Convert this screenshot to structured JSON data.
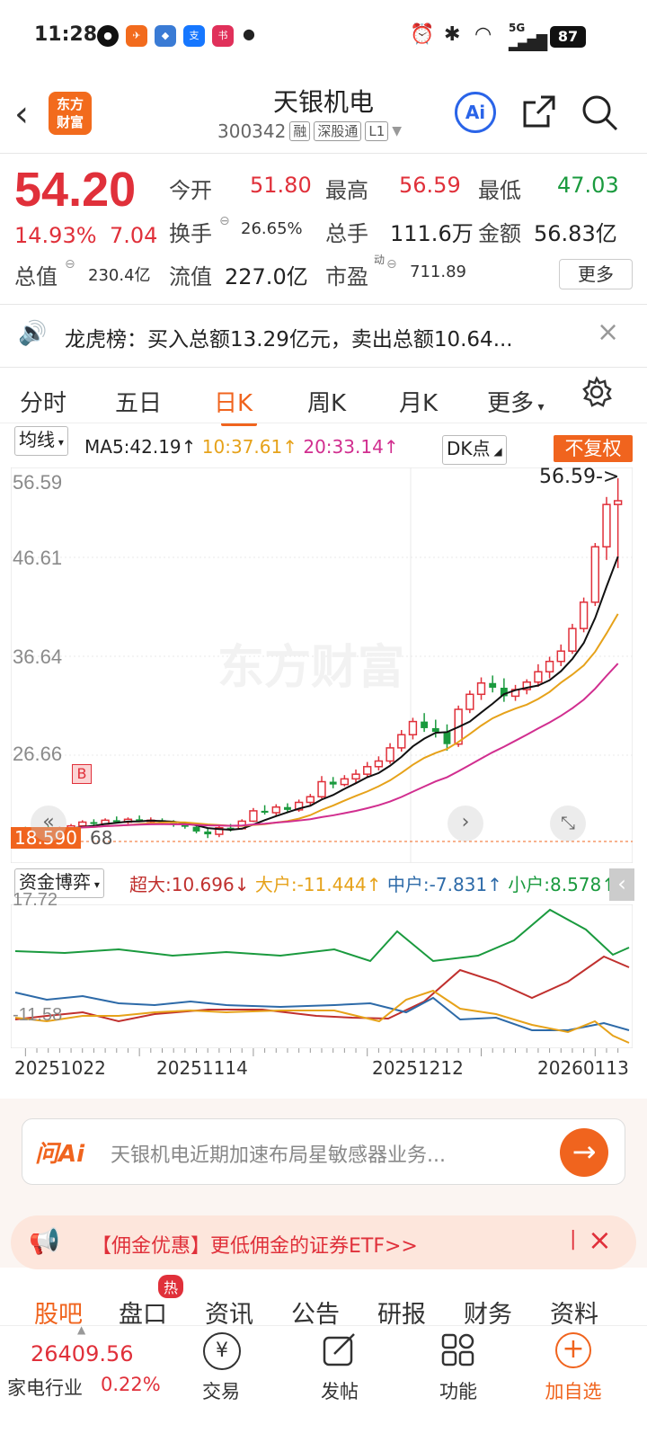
{
  "status_bar": {
    "time": "11:28",
    "battery": "87",
    "network": "5G"
  },
  "header": {
    "title": "天银机电",
    "code": "300342",
    "tag_rong": "融",
    "tag_market": "深股通",
    "tag_level": "L1",
    "logo_text_1": "东方",
    "logo_text_2": "财富"
  },
  "quote": {
    "price": "54.20",
    "change_pct": "14.93%",
    "change": "7.04",
    "open_label": "今开",
    "open": "51.80",
    "high_label": "最高",
    "high": "56.59",
    "low_label": "最低",
    "low": "47.03",
    "turnover_label": "换手",
    "turnover": "26.65%",
    "volume_label": "总手",
    "volume": "111.6万",
    "amount_label": "金额",
    "amount": "56.83亿",
    "total_value_label": "总值",
    "total_value": "230.4亿",
    "float_value_label": "流值",
    "float_value": "227.0亿",
    "pe_label": "市盈",
    "pe_sup": "动",
    "pe": "711.89",
    "more_label": "更多"
  },
  "notice": {
    "text": "龙虎榜：买入总额13.29亿元，卖出总额10.64..."
  },
  "tabs": [
    "分时",
    "五日",
    "日K",
    "周K",
    "月K",
    "更多"
  ],
  "active_tab": "日K",
  "kline": {
    "ma_select": "均线",
    "ma5": "MA5:42.19",
    "ma10": "10:37.61",
    "ma20": "20:33.14",
    "dk_label": "DK点",
    "fq_label": "不复权",
    "y_labels": [
      "56.59",
      "46.61",
      "36.64",
      "26.66"
    ],
    "high_marker": "56.59->",
    "low_marker": "18.590",
    "low_marker_suffix": "68",
    "watermark": "东方财富"
  },
  "fund": {
    "select": "资金博弈",
    "super_large": "超大:10.696",
    "large": "大户:-11.444",
    "medium": "中户:-7.831",
    "small": "小户:8.578",
    "y_top": "17.72",
    "y_bottom": "-11.58",
    "dates": [
      "20251022",
      "20251114",
      "20251212",
      "20260113"
    ]
  },
  "ai": {
    "brand": "问Ai",
    "placeholder": "天银机电近期加速布局星敏感器业务..."
  },
  "promo": {
    "text": "【佣金优惠】更低佣金的证券ETF>>"
  },
  "bottom_tabs": [
    "股吧",
    "盘口",
    "资讯",
    "公告",
    "研报",
    "财务",
    "资料"
  ],
  "hot_badge": "热",
  "index_info": {
    "value": "26409.56",
    "name": "家电行业",
    "change": "0.22%"
  },
  "nav": [
    "交易",
    "发帖",
    "功能",
    "加自选"
  ],
  "colors": {
    "up": "#e0303a",
    "down": "#1a9a3e",
    "accent": "#f0641e"
  },
  "chart_data": {
    "type": "candlestick",
    "ylim": [
      16.6,
      56.59
    ],
    "candles": [
      [
        19.2,
        19.5,
        18.9,
        19.1
      ],
      [
        19.1,
        19.4,
        18.8,
        19.3
      ],
      [
        19.3,
        19.6,
        19.0,
        19.2
      ],
      [
        19.2,
        19.5,
        19.0,
        19.4
      ],
      [
        19.4,
        19.8,
        19.2,
        19.6
      ],
      [
        19.6,
        20.2,
        19.4,
        20.0
      ],
      [
        20.0,
        20.3,
        19.6,
        19.8
      ],
      [
        19.8,
        20.4,
        19.7,
        20.2
      ],
      [
        20.2,
        20.6,
        19.9,
        20.0
      ],
      [
        20.0,
        20.5,
        19.8,
        20.3
      ],
      [
        20.3,
        20.7,
        20.0,
        20.1
      ],
      [
        20.1,
        20.5,
        19.8,
        20.2
      ],
      [
        20.2,
        20.4,
        19.7,
        19.9
      ],
      [
        19.9,
        20.2,
        19.5,
        19.7
      ],
      [
        19.7,
        20.0,
        19.3,
        19.5
      ],
      [
        19.5,
        19.8,
        18.8,
        19.0
      ],
      [
        19.0,
        19.4,
        18.3,
        18.7
      ],
      [
        18.7,
        19.6,
        18.4,
        19.4
      ],
      [
        19.4,
        19.8,
        19.0,
        19.3
      ],
      [
        19.3,
        20.3,
        19.2,
        20.1
      ],
      [
        20.1,
        21.5,
        20.0,
        21.2
      ],
      [
        21.2,
        21.8,
        20.8,
        21.0
      ],
      [
        21.0,
        21.9,
        20.7,
        21.6
      ],
      [
        21.6,
        22.0,
        21.0,
        21.3
      ],
      [
        21.3,
        22.4,
        21.1,
        22.1
      ],
      [
        22.1,
        23.0,
        21.8,
        22.7
      ],
      [
        22.7,
        24.9,
        22.5,
        24.3
      ],
      [
        24.3,
        24.8,
        23.6,
        24.0
      ],
      [
        24.0,
        25.0,
        23.8,
        24.6
      ],
      [
        24.6,
        25.6,
        24.2,
        25.1
      ],
      [
        25.1,
        26.4,
        24.8,
        25.9
      ],
      [
        25.9,
        27.0,
        25.5,
        26.5
      ],
      [
        26.5,
        28.4,
        26.2,
        27.9
      ],
      [
        27.9,
        29.8,
        27.5,
        29.3
      ],
      [
        29.3,
        31.1,
        28.8,
        30.7
      ],
      [
        30.7,
        31.6,
        29.6,
        30.0
      ],
      [
        30.0,
        30.9,
        29.0,
        29.6
      ],
      [
        29.6,
        30.4,
        27.6,
        28.3
      ],
      [
        28.3,
        32.4,
        28.0,
        32.0
      ],
      [
        32.0,
        34.0,
        31.6,
        33.6
      ],
      [
        33.6,
        35.4,
        33.0,
        34.8
      ],
      [
        34.8,
        35.6,
        33.8,
        34.3
      ],
      [
        34.3,
        35.3,
        32.8,
        33.4
      ],
      [
        33.4,
        34.6,
        32.9,
        34.1
      ],
      [
        34.1,
        35.2,
        33.6,
        34.9
      ],
      [
        34.9,
        36.8,
        34.4,
        36.0
      ],
      [
        36.0,
        37.6,
        35.3,
        37.1
      ],
      [
        37.1,
        38.9,
        36.6,
        38.2
      ],
      [
        38.2,
        41.1,
        37.9,
        40.6
      ],
      [
        40.6,
        43.9,
        40.2,
        43.4
      ],
      [
        43.4,
        49.7,
        43.0,
        49.3
      ],
      [
        49.3,
        54.6,
        47.9,
        53.8
      ],
      [
        53.8,
        56.59,
        47.03,
        54.2
      ]
    ]
  }
}
